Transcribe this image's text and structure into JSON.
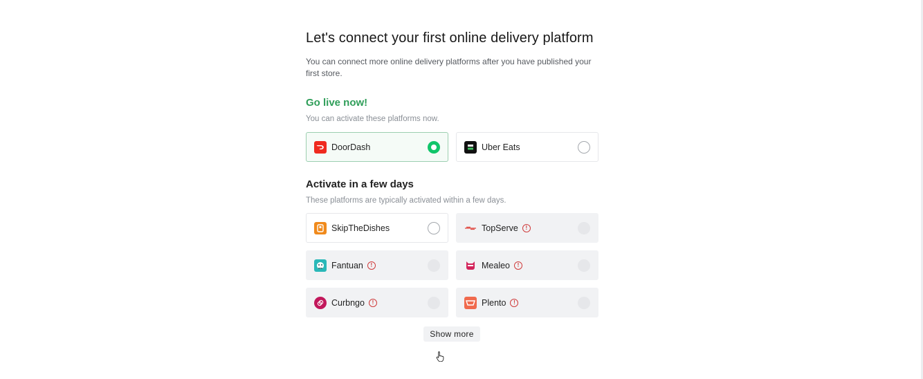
{
  "header": {
    "title": "Let's connect your first online delivery platform",
    "subtitle": "You can connect more online delivery platforms after you have published your first store."
  },
  "go_live": {
    "heading": "Go live now!",
    "description": "You can activate these platforms now.",
    "platforms": [
      {
        "name": "DoorDash",
        "selected": true,
        "logo_color": "#ef2a1f",
        "icon": "doordash-logo-icon"
      },
      {
        "name": "Uber Eats",
        "selected": false,
        "logo_color": "#111111",
        "icon": "uber-eats-logo-icon"
      }
    ]
  },
  "few_days": {
    "heading": "Activate in a few days",
    "description": "These platforms are typically activated within a few days.",
    "platforms": [
      {
        "name": "SkipTheDishes",
        "warning": false,
        "disabled": false,
        "logo_color": "#f08a1c",
        "icon": "skipthedishes-logo-icon"
      },
      {
        "name": "TopServe",
        "warning": true,
        "disabled": true,
        "logo_color": "#e0433a",
        "icon": "topserve-logo-icon"
      },
      {
        "name": "Fantuan",
        "warning": true,
        "disabled": true,
        "logo_color": "#2ab8b8",
        "icon": "fantuan-logo-icon"
      },
      {
        "name": "Mealeo",
        "warning": true,
        "disabled": true,
        "logo_color": "#d3245b",
        "icon": "mealeo-logo-icon"
      },
      {
        "name": "Curbngo",
        "warning": true,
        "disabled": true,
        "logo_color": "#c2185b",
        "icon": "curbngo-logo-icon"
      },
      {
        "name": "Plento",
        "warning": true,
        "disabled": true,
        "logo_color": "#f06a4d",
        "icon": "plento-logo-icon"
      }
    ]
  },
  "show_more_label": "Show more",
  "colors": {
    "accent_green": "#11c56a",
    "heading_green": "#2f9e59",
    "warning_red": "#cf3a3a"
  }
}
